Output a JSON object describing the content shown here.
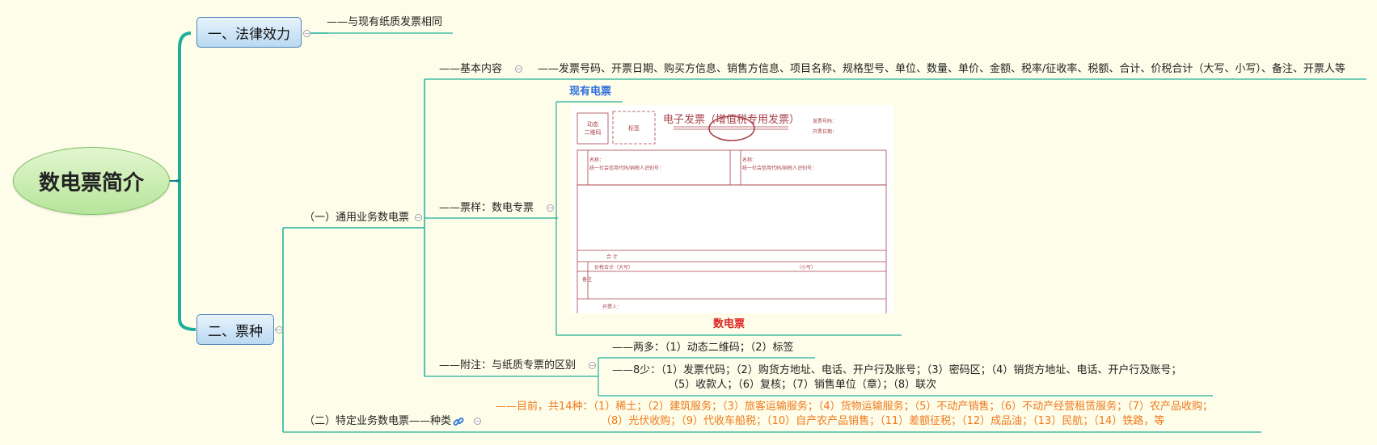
{
  "root": {
    "label": "数电票简介"
  },
  "branch1": {
    "label": "一、法律效力",
    "note": "——与现有纸质发票相同"
  },
  "branch2": {
    "label": "二、票种"
  },
  "sub1": {
    "label": "（一）通用业务数电票",
    "basic": {
      "label": "——基本内容",
      "detail": "——发票号码、开票日期、购买方信息、销售方信息、项目名称、规格型号、单位、数量、单价、金额、税率/征收率、税额、合计、价税合计（大写、小写）、备注、开票人等"
    },
    "sample": {
      "label": "——票样：数电专票",
      "top_caption": "现有电票",
      "bottom_caption": "数电票"
    },
    "appendix": {
      "label": "——附注：与纸质专票的区别",
      "two_more": "——两多：（1）动态二维码；（2）标签",
      "eight_less_1": "——8少：（1）发票代码；（2）购货方地址、电话、开户行及账号；（3）密码区；（4）销货方地址、电话、开户行及账号；",
      "eight_less_2": "（5）收款人；（6）复核；（7）销售单位（章）；（8）联次"
    }
  },
  "sub2": {
    "label": "（二）特定业务数电票——种类",
    "line1": "——目前，共14种：（1）稀土；（2）建筑服务；（3）旅客运输服务；（4）货物运输服务；（5）不动产销售；（6）不动产经营租赁服务；（7）农产品收购；",
    "line2": "（8）光伏收购；（9）代收车船税；（10）自产农产品销售；（11）差额征税；（12）成品油；（13）民航；（14）铁路，等"
  },
  "invoice": {
    "title": "电子发票（增值税专用发票）",
    "qr": "动态\n二维码",
    "tag": "标签",
    "invoice_no": "发票号码：",
    "date": "开票日期：",
    "buyer_side": "购买方信息",
    "seller_side": "销售方信息",
    "name": "名称：",
    "tax_id": "统一社会信用代码/纳税人识别号：",
    "total": "合    计",
    "total_price": "价税合计（大写）",
    "small": "（小写）",
    "remark": "备注",
    "drawer": "开票人："
  },
  "colors": {
    "connector": "#1fae9c",
    "trunk": "#0e7e8c",
    "invoice_red": "#a8424a",
    "orange": "#ee7a1e"
  }
}
